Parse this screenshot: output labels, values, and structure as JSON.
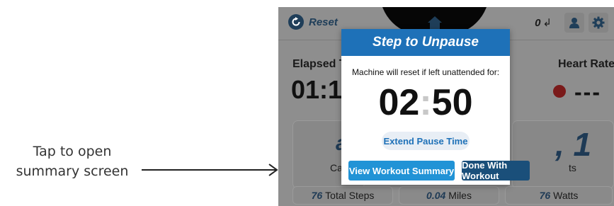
{
  "annotation": {
    "line1": "Tap to open",
    "line2": "summary  screen"
  },
  "topbar": {
    "reset_label": "Reset",
    "steps_count": "0",
    "steps_glyph": "↲"
  },
  "stats": {
    "elapsed_label": "Elapsed Ti",
    "elapsed_value": "01:1",
    "heart_rate_label": "Heart Rate",
    "heart_rate_value": "---"
  },
  "cards": {
    "left_partial": "a",
    "left_label": "Cal",
    "right_partial": ", 1",
    "right_label": "ts"
  },
  "metrics": [
    {
      "value": "76",
      "label": "Total Steps"
    },
    {
      "value": "0.04",
      "label": "Miles"
    },
    {
      "value": "76",
      "label": "Watts"
    }
  ],
  "modal": {
    "title": "Step to Unpause",
    "message": "Machine will reset if left unattended for:",
    "minutes": "02",
    "separator": ":",
    "seconds": "50",
    "extend_label": "Extend Pause Time",
    "summary_label": "View Workout Summary",
    "done_label": "Done With Workout"
  },
  "colors": {
    "header_blue": "#1e71b8",
    "summary_button": "#2193d6",
    "done_button": "#1a4f7a",
    "overlay_gray": "#8e8e8e"
  },
  "icons": {
    "reset": "reset-icon",
    "home": "home-icon",
    "user": "user-icon",
    "settings": "gear-icon",
    "heart": "heart-icon",
    "arrow": "arrow-right-icon"
  }
}
